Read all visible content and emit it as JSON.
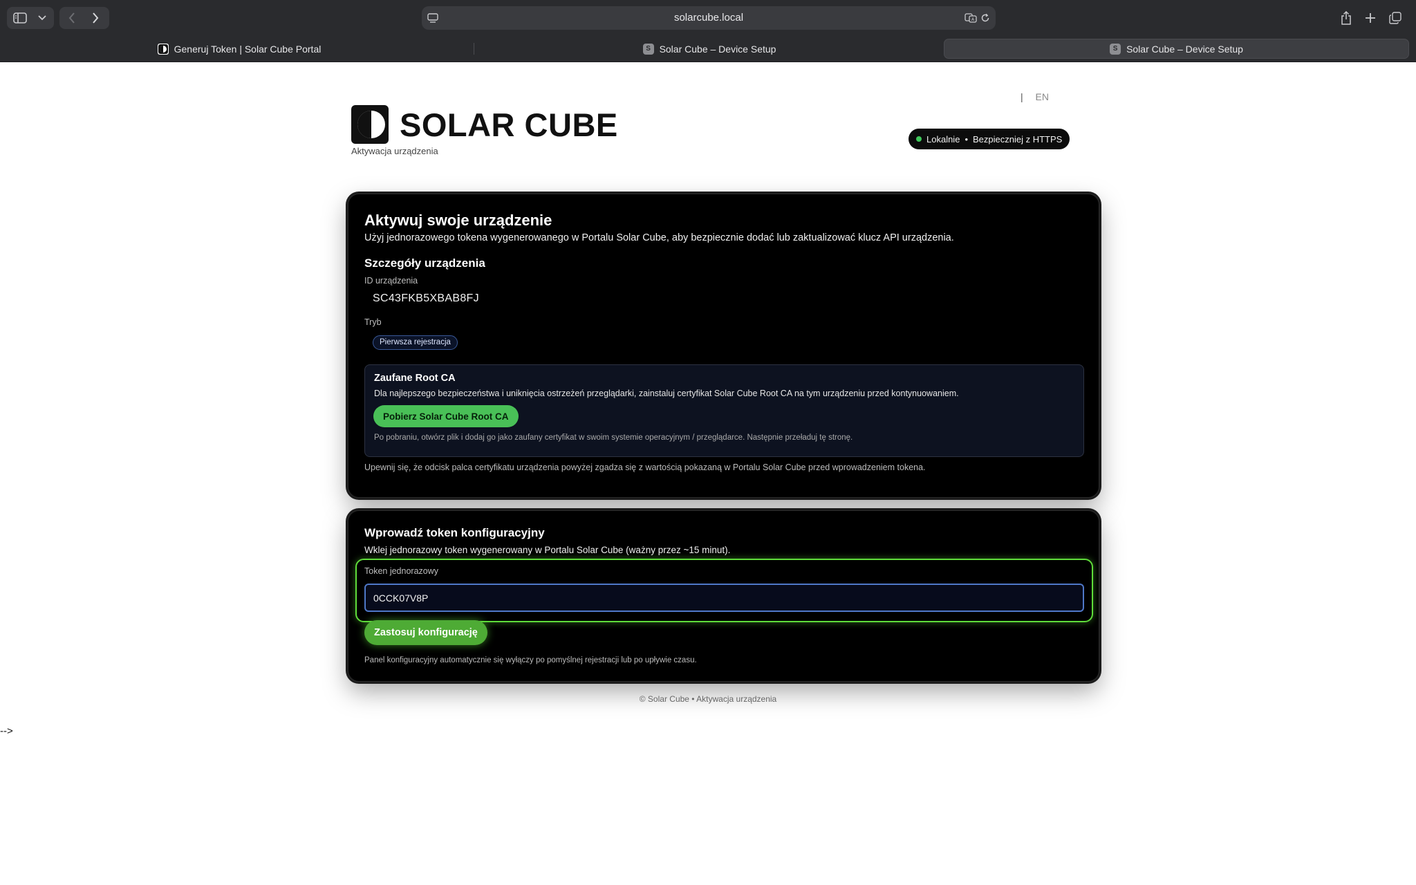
{
  "browser": {
    "url": "solarcube.local",
    "tabs": [
      {
        "label": "Generuj Token | Solar Cube Portal",
        "favicon": "S",
        "active": false
      },
      {
        "label": "Solar Cube – Device Setup",
        "favicon": "S",
        "active": false
      },
      {
        "label": "Solar Cube – Device Setup",
        "favicon": "S",
        "active": true
      }
    ]
  },
  "header": {
    "lang_separator": "|",
    "lang": "EN",
    "brand": "SOLAR CUBE",
    "tagline": "Aktywacja urządzenia",
    "status": {
      "left": "Lokalnie",
      "dot_sep": "•",
      "right": "Bezpieczniej z HTTPS"
    }
  },
  "activate_card": {
    "title": "Aktywuj swoje urządzenie",
    "lead": "Użyj jednorazowego tokena wygenerowanego w Portalu Solar Cube, aby bezpiecznie dodać lub zaktualizować klucz API urządzenia.",
    "details_title": "Szczegóły urządzenia",
    "device_id_label": "ID urządzenia",
    "device_id": "SC43FKB5XBAB8FJ",
    "mode_label": "Tryb",
    "mode": "Pierwsza rejestracja",
    "ca": {
      "title": "Zaufane Root CA",
      "text": "Dla najlepszego bezpieczeństwa i uniknięcia ostrzeżeń przeglądarki, zainstaluj certyfikat Solar Cube Root CA na tym urządzeniu przed kontynuowaniem.",
      "button": "Pobierz Solar Cube Root CA",
      "note": "Po pobraniu, otwórz plik i dodaj go jako zaufany certyfikat w swoim systemie operacyjnym / przeglądarce. Następnie przeładuj tę stronę."
    },
    "fingerprint_note": "Upewnij się, że odcisk palca certyfikatu urządzenia powyżej zgadza się z wartością pokazaną w Portalu Solar Cube przed wprowadzeniem tokena."
  },
  "token_card": {
    "title": "Wprowadź token konfiguracyjny",
    "lead": "Wklej jednorazowy token wygenerowany w Portalu Solar Cube (ważny przez ~15 minut).",
    "token_label": "Token jednorazowy",
    "token_value": "0CCK07V8P",
    "apply_button": "Zastosuj konfigurację",
    "auto_note": "Panel konfiguracyjny automatycznie się wyłączy po pomyślnej rejestracji lub po upływie czasu."
  },
  "footer": "© Solar Cube • Aktywacja urządzenia",
  "stray_text": "-->",
  "colors": {
    "accent_green": "#49c057",
    "glow_green": "#5fdc3a",
    "input_border": "#4f78c8",
    "status_dot": "#3ec75a"
  }
}
